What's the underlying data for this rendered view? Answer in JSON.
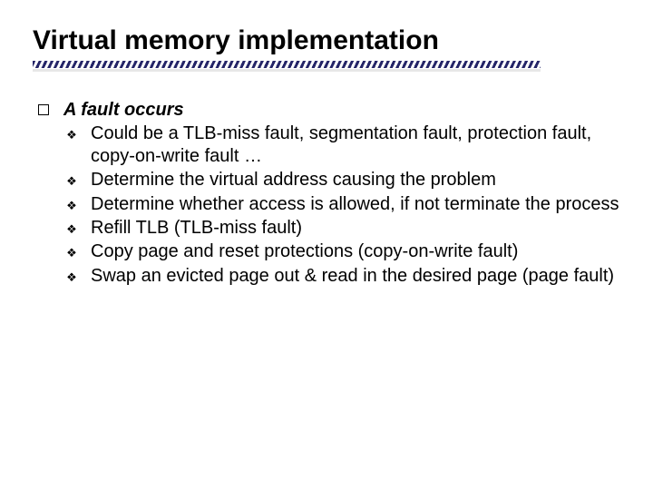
{
  "title": "Virtual memory implementation",
  "section": {
    "heading": "A fault occurs",
    "items": [
      "Could be a TLB-miss fault, segmentation fault, protection fault, copy-on-write fault …",
      "Determine the virtual address causing the problem",
      "Determine whether access is allowed, if not terminate the process",
      "Refill TLB (TLB-miss fault)",
      "Copy page and reset protections (copy-on-write fault)",
      "Swap an evicted page out & read in the desired page (page fault)"
    ]
  }
}
